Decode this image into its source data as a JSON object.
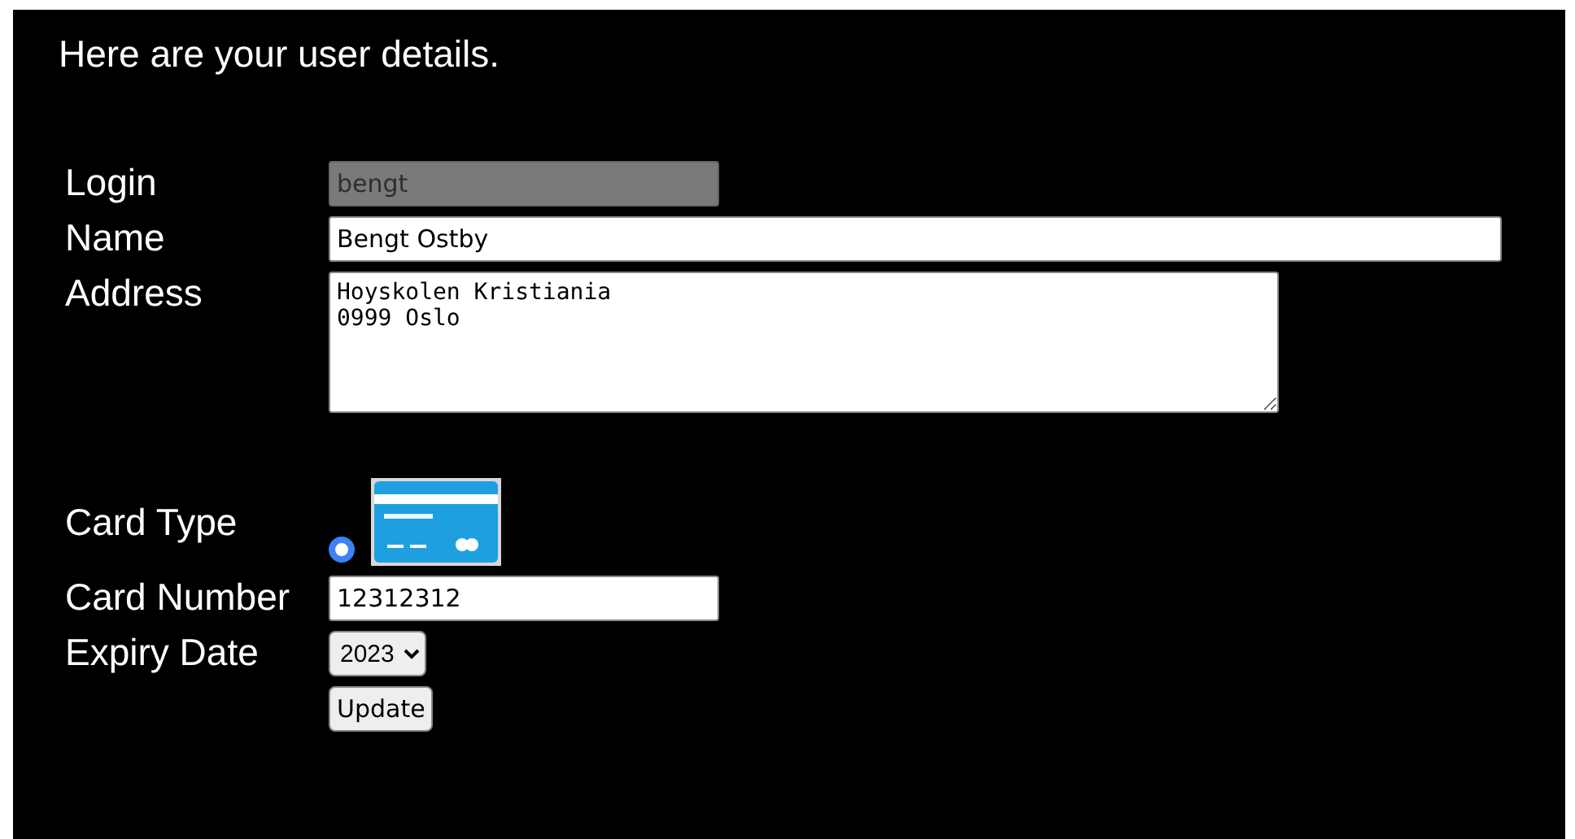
{
  "heading": "Here are your user details.",
  "login": {
    "label": "Login",
    "value": "bengt",
    "disabled": true
  },
  "name": {
    "label": "Name",
    "value": "Bengt Ostby"
  },
  "address": {
    "label": "Address",
    "value": "Hoyskolen Kristiania\n0999 Oslo"
  },
  "card_type": {
    "label": "Card Type",
    "options": [
      {
        "kind": "picture",
        "selected": true
      }
    ]
  },
  "card_number": {
    "label": "Card Number",
    "value": "12312312"
  },
  "expiry": {
    "label": "Expiry Date",
    "value": "2023"
  },
  "submit": "Update"
}
